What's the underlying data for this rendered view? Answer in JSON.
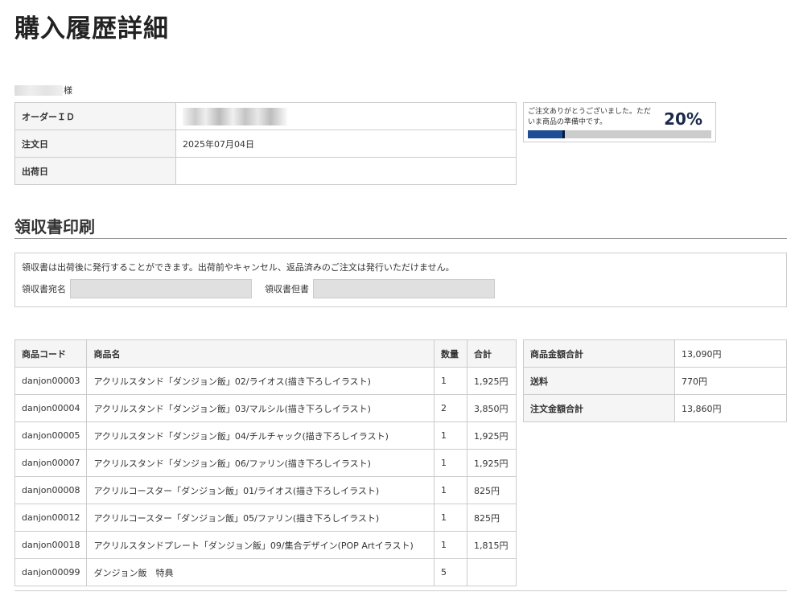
{
  "page": {
    "title": "購入履歴詳細"
  },
  "customer": {
    "suffix": "様"
  },
  "order": {
    "rows": [
      {
        "label": "オーダーＩＤ",
        "value": ""
      },
      {
        "label": "注文日",
        "value": "2025年07月04日"
      },
      {
        "label": "出荷日",
        "value": ""
      }
    ]
  },
  "progress": {
    "message": "ご注文ありがとうございました。ただいま商品の準備中です。",
    "percent_label": "20%",
    "value": 0.2
  },
  "receipt": {
    "section_title": "領収書印刷",
    "notice": "領収書は出荷後に発行することができます。出荷前やキャンセル、返品済みのご注文は発行いただけません。",
    "addressee_label": "領収書宛名",
    "addressee_value": "",
    "note_label": "領収書但書",
    "note_value": ""
  },
  "items": {
    "headers": {
      "code": "商品コード",
      "name": "商品名",
      "qty": "数量",
      "total": "合計"
    },
    "rows": [
      {
        "code": "danjon00003",
        "name": "アクリルスタンド「ダンジョン飯」02/ライオス(描き下ろしイラスト)",
        "qty": "1",
        "total": "1,925円"
      },
      {
        "code": "danjon00004",
        "name": "アクリルスタンド「ダンジョン飯」03/マルシル(描き下ろしイラスト)",
        "qty": "2",
        "total": "3,850円"
      },
      {
        "code": "danjon00005",
        "name": "アクリルスタンド「ダンジョン飯」04/チルチャック(描き下ろしイラスト)",
        "qty": "1",
        "total": "1,925円"
      },
      {
        "code": "danjon00007",
        "name": "アクリルスタンド「ダンジョン飯」06/ファリン(描き下ろしイラスト)",
        "qty": "1",
        "total": "1,925円"
      },
      {
        "code": "danjon00008",
        "name": "アクリルコースター「ダンジョン飯」01/ライオス(描き下ろしイラスト)",
        "qty": "1",
        "total": "825円"
      },
      {
        "code": "danjon00012",
        "name": "アクリルコースター「ダンジョン飯」05/ファリン(描き下ろしイラスト)",
        "qty": "1",
        "total": "825円"
      },
      {
        "code": "danjon00018",
        "name": "アクリルスタンドプレート「ダンジョン飯」09/集合デザイン(POP Artイラスト)",
        "qty": "1",
        "total": "1,815円"
      },
      {
        "code": "danjon00099",
        "name": "ダンジョン飯　特典",
        "qty": "5",
        "total": ""
      }
    ]
  },
  "totals": {
    "rows": [
      {
        "label": "商品金額合計",
        "value": "13,090円"
      },
      {
        "label": "送料",
        "value": "770円"
      },
      {
        "label": "注文金額合計",
        "value": "13,860円"
      }
    ]
  }
}
